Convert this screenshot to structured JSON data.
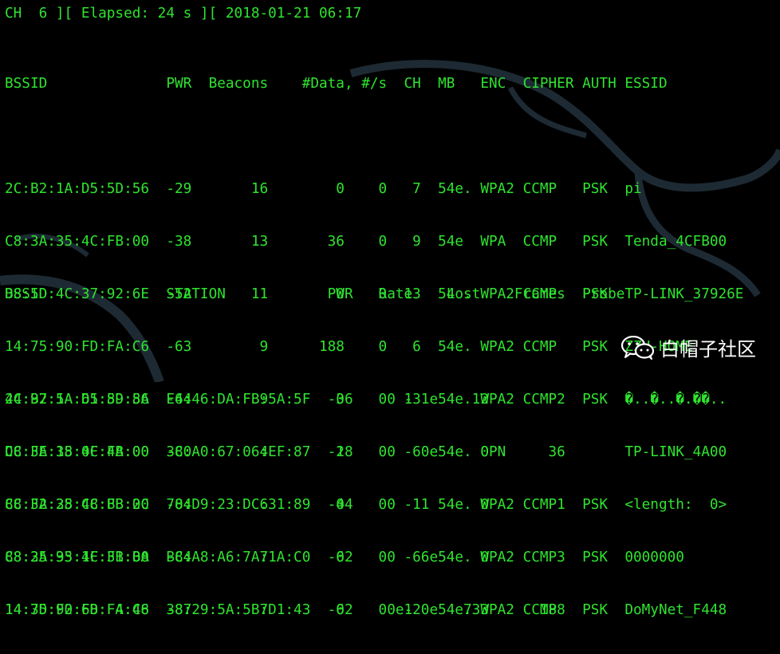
{
  "status_line": {
    "text": "CH  6 ][ Elapsed: 24 s ][ 2018-01-21 06:17"
  },
  "ap_table": {
    "header": "BSSID              PWR  Beacons    #Data, #/s  CH  MB   ENC  CIPHER AUTH ESSID",
    "rows": [
      "2C:B2:1A:D5:5D:56  -29       16        0    0   7  54e. WPA2 CCMP   PSK  pi",
      "C8:3A:35:4C:FB:00  -38       13       36    0   9  54e  WPA  CCMP   PSK  Tenda_4CFB00",
      "D8:5D:4C:37:92:6E  -52       11        0    0  13  54 . WPA2 CCMP   PSK  TP-LINK_37926E",
      "14:75:90:FD:FA:C6  -63        9      188    0   6  54e. WPA2 CCMP   PSK  ZZH-HOME",
      "44:97:5A:61:89:8A  -64        9        0    0  13  54e. WPA2 CCMP   PSK  �..�..�.��..",
      "DC:FE:18:0F:4A:00  -80        4        1    0   6  54e. OPN              TP-LINK_4A00",
      "8C:F2:28:C8:BB:2C  -84        6        0    0   1  54e. WPA2 CCMP   PSK  <length:  0>",
      "88:25:93:1F:31:BA  -84        7        0    0   6  54e. WPA2 CCMP   PSK  0000000",
      "14:3D:F2:68:F4:48  -87        7        0    0  12  54e. WPA2 CCMP   PSK  DoMyNet_F448"
    ]
  },
  "station_table": {
    "header": "BSSID              STATION            PWR   Rate    Lost    Frames  Probe",
    "rows": [
      "2C:B2:1A:D5:5D:56  E4:46:DA:FB:5A:5F  -36    0 - 1e    12        2",
      "C8:3A:35:4C:FB:00  3C:A0:67:06:EF:87  -28    0 - 0e     0       36",
      "C8:3A:35:4C:FB:00  70:D9:23:DC:31:89  -44    0 - 1      0        1",
      "C8:3A:35:4C:FB:00  BC:A8:A6:7A:1A:C0  -62    0 - 6e     0        3",
      "14:75:90:FD:FA:C6  38:29:5A:5B:D1:43  -62    0e- 0e   733      188"
    ]
  },
  "watermark": {
    "text": "白帽子社区",
    "icon": "wechat-icon"
  },
  "colors": {
    "background": "#000000",
    "terminal_text": "#2fe32f",
    "watermark": "#ffffff",
    "dragon": "#1d2a33"
  }
}
